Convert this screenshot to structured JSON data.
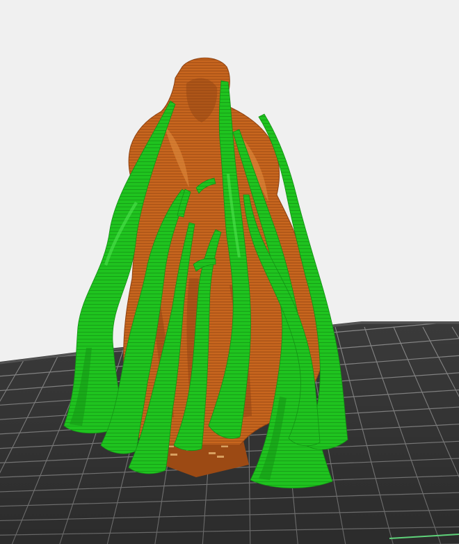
{
  "viewport": {
    "background_color": "#f0f0f0"
  },
  "build_plate": {
    "plate_color": "#3a3a3a",
    "grid_color": "#8a8a8a",
    "edge_color": "#565656",
    "accent_line_color": "#5fd37a"
  },
  "model": {
    "body_color": "#c8661e",
    "body_dark_color": "#8f4211",
    "body_highlight_color": "#e08a3c",
    "base_color": "#9c4a14",
    "base_detail_color": "#d8a060"
  },
  "supports": {
    "color": "#1fc31f",
    "dark_color": "#149014",
    "highlight_color": "#4fe44f",
    "count": 11
  }
}
